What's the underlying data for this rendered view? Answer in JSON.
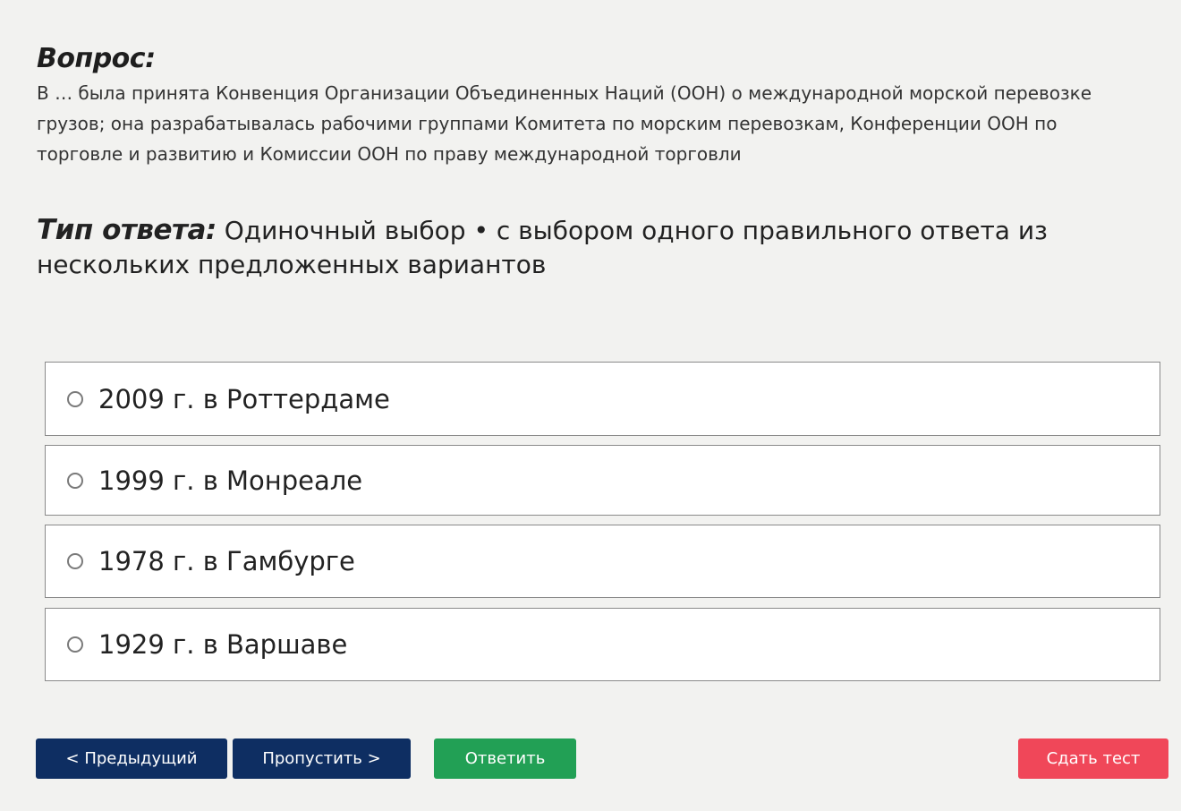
{
  "question": {
    "heading": "Вопрос:",
    "text": "В … была принята Конвенция Организации Объединенных Наций (ООН) о международной морской перевозке грузов; она разрабатывалась рабочими группами Комитета по морским перевозкам, Конференции ООН по торговле и развитию и Комиссии ООН по праву международной торговли"
  },
  "answer_type": {
    "label": "Тип ответа:",
    "value": "Одиночный выбор • с выбором одного правильного ответа из нескольких предложенных вариантов"
  },
  "options": [
    {
      "label": "2009 г. в Роттердаме",
      "selected": false
    },
    {
      "label": "1999 г. в Монреале",
      "selected": false
    },
    {
      "label": "1978 г. в Гамбурге",
      "selected": false
    },
    {
      "label": "1929 г. в Варшаве",
      "selected": false
    }
  ],
  "buttons": {
    "prev": "< Предыдущий",
    "skip": "Пропустить >",
    "answer": "Ответить",
    "submit": "Сдать тест"
  },
  "colors": {
    "nav_button": "#0e2e62",
    "answer_button": "#22a055",
    "submit_button": "#f04759",
    "background": "#f2f2f0"
  }
}
